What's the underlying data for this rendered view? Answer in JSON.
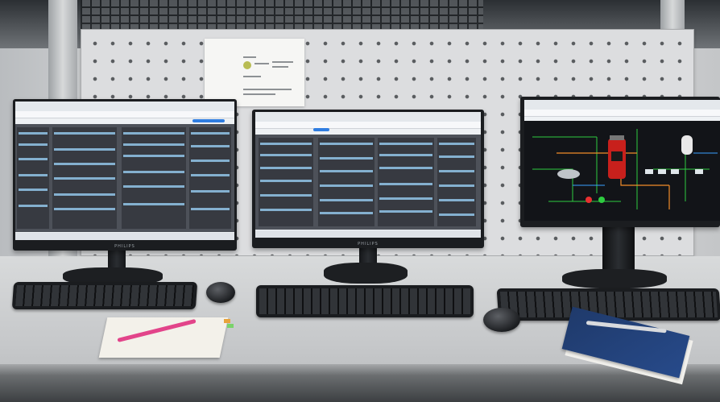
{
  "scene": {
    "description_tags": [
      "workstation-desk",
      "pegboard-wall",
      "three-monitors",
      "keyboards",
      "mice",
      "notebook",
      "booklet"
    ]
  },
  "monitors": [
    {
      "brand": "PHILIPS",
      "content": "dashboard"
    },
    {
      "brand": "PHILIPS",
      "content": "dashboard"
    },
    {
      "brand": "",
      "content": "scada-process-diagram"
    }
  ],
  "colors": {
    "pegboard": "#dcdddf",
    "desk": "#d0d2d4",
    "monitor_bezel": "#1b1d20",
    "dashboard_link": "#9fd8ff",
    "scada_bg": "#121418",
    "scada_tank": "#c8201c",
    "pen_pink": "#e2448a",
    "booklet_blue": "#1f3a6b"
  }
}
